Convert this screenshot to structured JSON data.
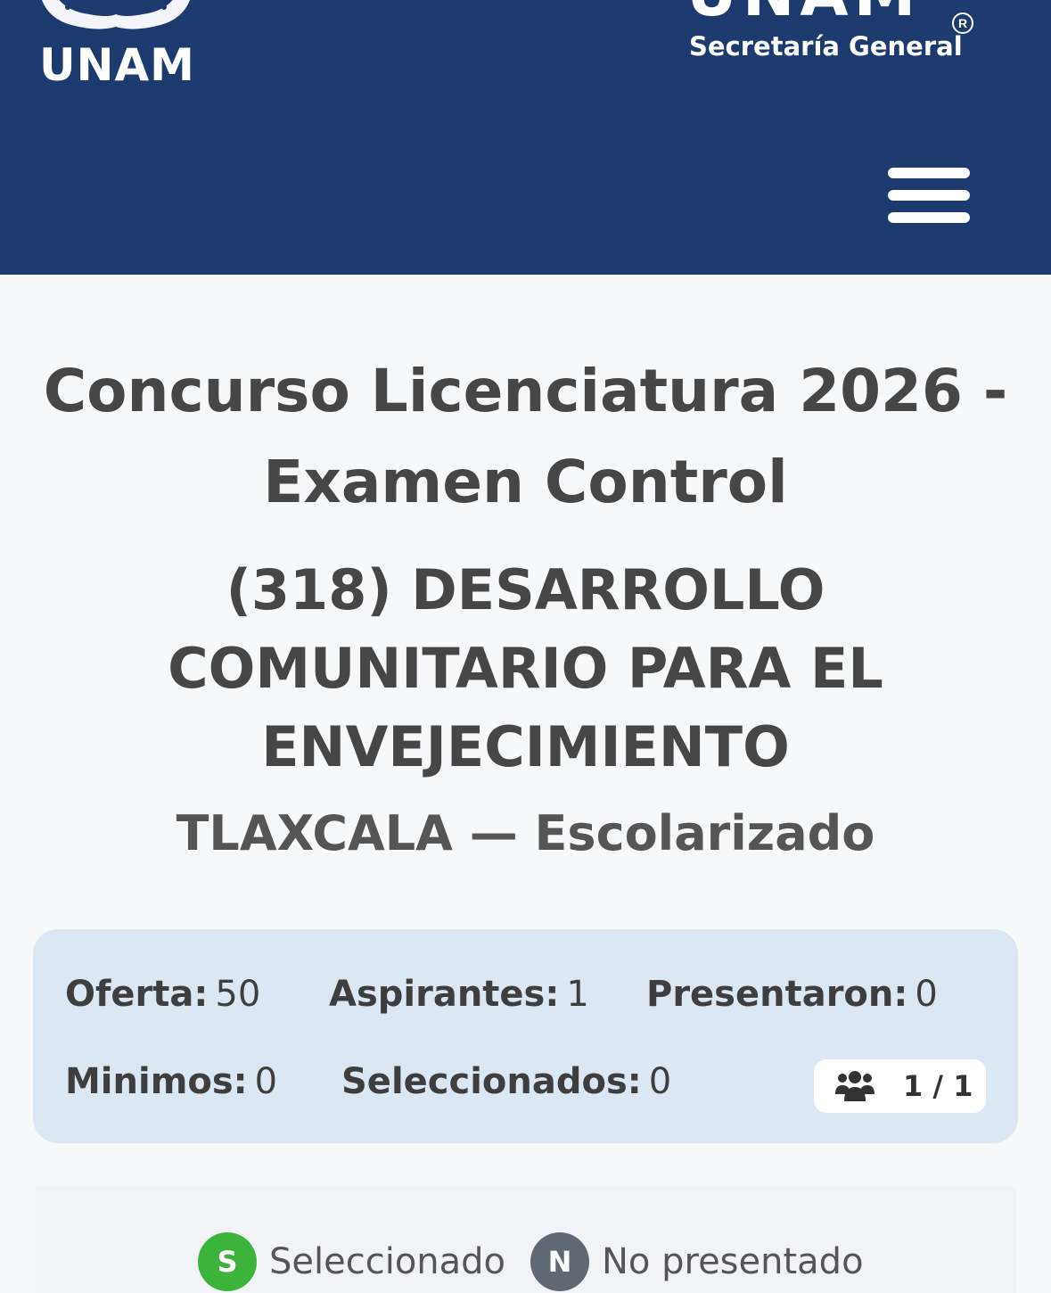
{
  "header": {
    "left_logo_text": "UNAM",
    "right_logo_text": "UNAM",
    "right_logo_sub": "Secretaría General",
    "registered_mark": "R",
    "bg_color": "#1c3a6e"
  },
  "title": "Concurso Licenciatura 2026 - Examen Control",
  "career": "(318) DESARROLLO COMUNITARIO PARA EL ENVEJECIMIENTO",
  "campus": "TLAXCALA — Escolarizado",
  "stats": {
    "oferta_label": "Oferta:",
    "oferta_value": "50",
    "aspirantes_label": "Aspirantes:",
    "aspirantes_value": "1",
    "presentaron_label": "Presentaron:",
    "presentaron_value": "0",
    "minimos_label": "Minimos:",
    "minimos_value": "0",
    "seleccionados_label": "Seleccionados:",
    "seleccionados_value": "0",
    "count_icon": "users-icon",
    "count_text": "1 / 1",
    "card_color": "#dbe8f4"
  },
  "legend": [
    {
      "letter": "S",
      "label": "Seleccionado",
      "color": "#3cb43c"
    },
    {
      "letter": "N",
      "label": "No presentado",
      "color": "#5f6873"
    }
  ]
}
